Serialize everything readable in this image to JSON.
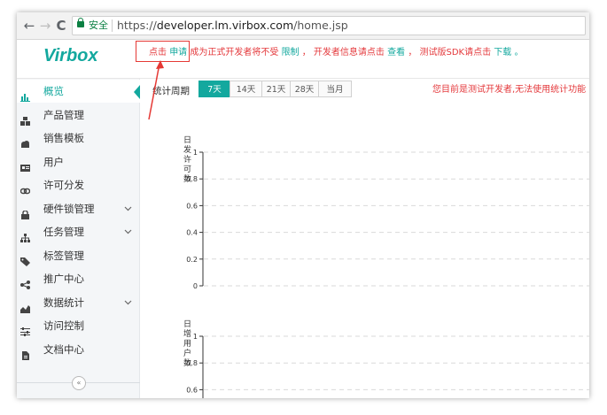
{
  "browser": {
    "secure_label": "安全",
    "url_scheme": "https://",
    "url_host": "developer.lm.virbox.com",
    "url_path": "/home.jsp",
    "back_icon": "←",
    "forward_icon": "→",
    "reload_icon": "C"
  },
  "notice": {
    "logo": "Virbox",
    "part1": "点击",
    "link1": "申请",
    "part2": "成为正式开发者将不受",
    "link2": "限制",
    "part3": "，  开发者信息请点击",
    "link3": "查看",
    "part4": "，  测试版SDK请点击",
    "link4": "下载",
    "part5": "。"
  },
  "sidebar": {
    "items": [
      {
        "label": "概览",
        "icon": "bar-chart-icon",
        "active": true
      },
      {
        "label": "产品管理",
        "icon": "cubes-icon"
      },
      {
        "label": "销售模板",
        "icon": "cloud-icon"
      },
      {
        "label": "用户",
        "icon": "id-card-icon"
      },
      {
        "label": "许可分发",
        "icon": "link-icon"
      },
      {
        "label": "硬件锁管理",
        "icon": "lock-icon",
        "expandable": true
      },
      {
        "label": "任务管理",
        "icon": "sitemap-icon",
        "expandable": true
      },
      {
        "label": "标签管理",
        "icon": "tag-icon"
      },
      {
        "label": "推广中心",
        "icon": "share-icon"
      },
      {
        "label": "数据统计",
        "icon": "area-chart-icon",
        "expandable": true
      },
      {
        "label": "访问控制",
        "icon": "sliders-icon"
      },
      {
        "label": "文档中心",
        "icon": "file-icon"
      }
    ],
    "collapse_glyph": "«",
    "chevron_glyph": "⌄"
  },
  "main": {
    "period_label": "统计周期",
    "periods": [
      "7天",
      "14天",
      "21天",
      "28天",
      "当月"
    ],
    "selected_period": "7天",
    "tip": "您目前是测试开发者,无法使用统计功能"
  },
  "colors": {
    "brand": "#13a89e",
    "warning": "#e4393c",
    "annotation": "#e53935"
  },
  "chart_data": [
    {
      "type": "line",
      "title": "日发许可数",
      "ylim": [
        0,
        1
      ],
      "yticks": [
        "1",
        "0.8",
        "0.6",
        "0.4",
        "0.2",
        "0"
      ],
      "series": [],
      "grid": true
    },
    {
      "type": "line",
      "title": "日增用户数",
      "ylim": [
        0,
        1
      ],
      "yticks": [
        "1",
        "0.8",
        "0.6"
      ],
      "series": [],
      "grid": true
    }
  ]
}
